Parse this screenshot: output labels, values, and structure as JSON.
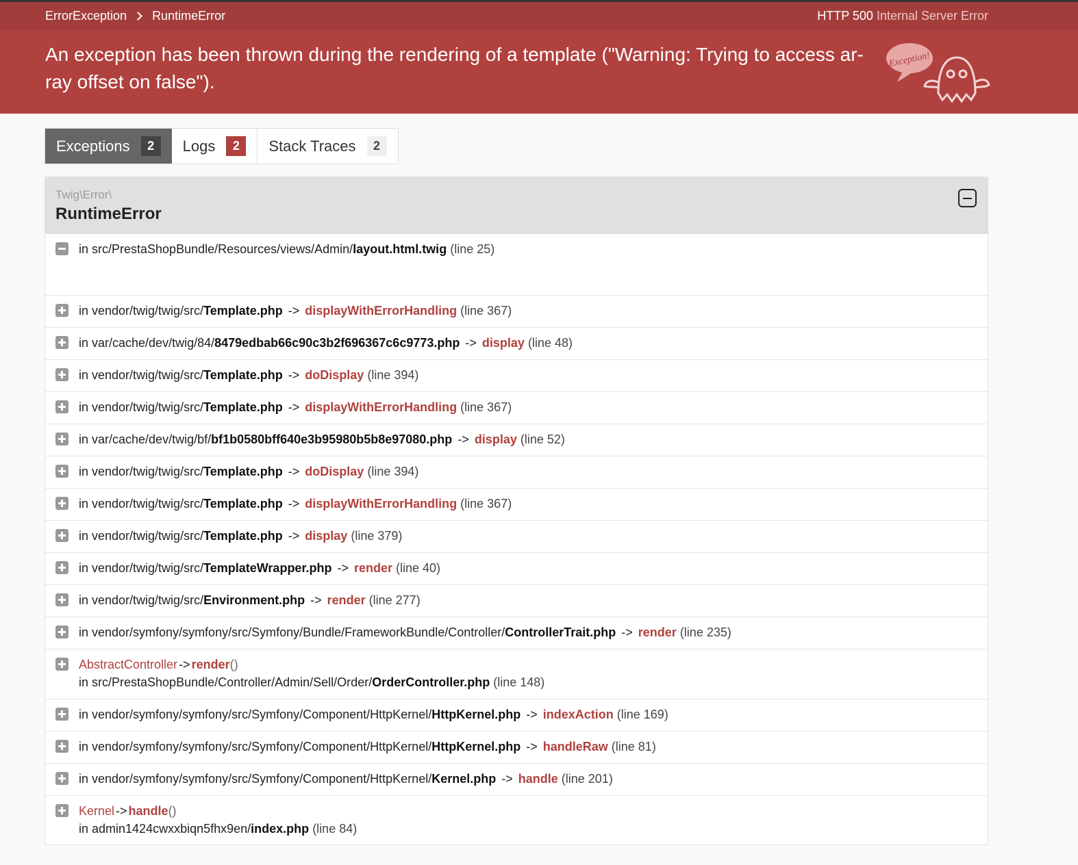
{
  "header": {
    "breadcrumb": [
      "ErrorException",
      "RuntimeError"
    ],
    "http_code": "HTTP 500",
    "http_text": "Internal Server Error",
    "message": "An exception has been thrown during the rendering of a template (\"Warning: Trying to access ar-ray offset on false\").",
    "message_line1": "An exception has been thrown during the rendering of a template (\"Warning: Trying to access ar-",
    "message_line2": "ray offset on false\").",
    "ghost_text": "Exception!"
  },
  "tabs": [
    {
      "label": "Exceptions",
      "count": "2"
    },
    {
      "label": "Logs",
      "count": "2"
    },
    {
      "label": "Stack Traces",
      "count": "2"
    }
  ],
  "exception": {
    "namespace": "Twig\\Error\\",
    "class": "RuntimeError"
  },
  "traces": [
    {
      "prefix": "in src/PrestaShopBundle/Resources/views/Admin/",
      "file": "layout.html.twig",
      "fn": "",
      "line": "(line 25)"
    },
    {
      "prefix": "in vendor/twig/twig/src/",
      "file": "Template.php",
      "fn": "displayWithErrorHandling",
      "line": "(line 367)"
    },
    {
      "prefix": "in var/cache/dev/twig/84/",
      "file": "8479edbab66c90c3b2f696367c6c9773.php",
      "fn": "display",
      "line": "(line 48)"
    },
    {
      "prefix": "in vendor/twig/twig/src/",
      "file": "Template.php",
      "fn": "doDisplay",
      "line": "(line 394)"
    },
    {
      "prefix": "in vendor/twig/twig/src/",
      "file": "Template.php",
      "fn": "displayWithErrorHandling",
      "line": "(line 367)"
    },
    {
      "prefix": "in var/cache/dev/twig/bf/",
      "file": "bf1b0580bff640e3b95980b5b8e97080.php",
      "fn": "display",
      "line": "(line 52)"
    },
    {
      "prefix": "in vendor/twig/twig/src/",
      "file": "Template.php",
      "fn": "doDisplay",
      "line": "(line 394)"
    },
    {
      "prefix": "in vendor/twig/twig/src/",
      "file": "Template.php",
      "fn": "displayWithErrorHandling",
      "line": "(line 367)"
    },
    {
      "prefix": "in vendor/twig/twig/src/",
      "file": "Template.php",
      "fn": "display",
      "line": "(line 379)"
    },
    {
      "prefix": "in vendor/twig/twig/src/",
      "file": "TemplateWrapper.php",
      "fn": "render",
      "line": "(line 40)"
    },
    {
      "prefix": "in vendor/twig/twig/src/",
      "file": "Environment.php",
      "fn": "render",
      "line": "(line 277)"
    },
    {
      "prefix": "in vendor/symfony/symfony/src/Symfony/Bundle/FrameworkBundle/Controller/",
      "file": "ControllerTrait.php",
      "fn": "render",
      "line": "(line 235)"
    },
    {
      "call_class": "AbstractController",
      "call_fn": "render",
      "prefix": "in src/PrestaShopBundle/Controller/Admin/Sell/Order/",
      "file": "OrderController.php",
      "line": "(line 148)"
    },
    {
      "prefix": "in vendor/symfony/symfony/src/Symfony/Component/HttpKernel/",
      "file": "HttpKernel.php",
      "fn": "indexAction",
      "line": "(line 169)"
    },
    {
      "prefix": "in vendor/symfony/symfony/src/Symfony/Component/HttpKernel/",
      "file": "HttpKernel.php",
      "fn": "handleRaw",
      "line": "(line 81)"
    },
    {
      "prefix": "in vendor/symfony/symfony/src/Symfony/Component/HttpKernel/",
      "file": "Kernel.php",
      "fn": "handle",
      "line": "(line 201)"
    },
    {
      "call_class": "Kernel",
      "call_fn": "handle",
      "prefix": "in admin1424cwxxbiqn5fhx9en/",
      "file": "index.php",
      "line": "(line 84)"
    }
  ],
  "symbols": {
    "arrow": "->",
    "parens": "()"
  },
  "colors": {
    "header": "#b0413e",
    "header_bar": "#a33d3b",
    "accent": "#b0413e"
  }
}
